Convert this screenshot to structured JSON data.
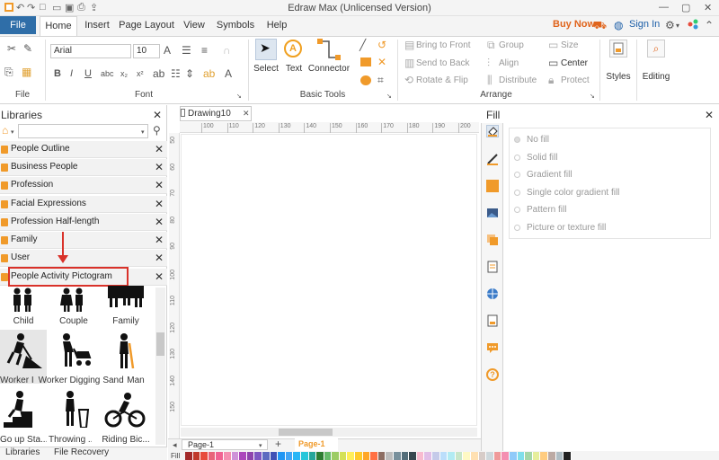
{
  "title": "Edraw Max (Unlicensed Version)",
  "menu": {
    "file": "File",
    "tabs": [
      "Home",
      "Insert",
      "Page Layout",
      "View",
      "Symbols",
      "Help"
    ]
  },
  "topright": {
    "buy": "Buy Now",
    "signin": "Sign In"
  },
  "ribbon": {
    "font_name": "Arial",
    "font_size": "10",
    "groups": {
      "file": "File",
      "font": "Font",
      "basic_tools": "Basic Tools",
      "arrange": "Arrange"
    },
    "tools": {
      "select": "Select",
      "text": "Text",
      "connector": "Connector"
    },
    "arrange": {
      "bring_front": "Bring to Front",
      "send_back": "Send to Back",
      "rotate_flip": "Rotate & Flip",
      "group": "Group",
      "align": "Align",
      "distribute": "Distribute",
      "size": "Size",
      "center": "Center",
      "protect": "Protect"
    },
    "styles": "Styles",
    "editing": "Editing"
  },
  "libraries": {
    "title": "Libraries",
    "items": [
      "People Outline",
      "Business People",
      "Profession",
      "Facial Expressions",
      "Profession Half-length",
      "Family",
      "User",
      "People Activity Pictogram"
    ],
    "shapes": [
      {
        "label": "Child"
      },
      {
        "label": "Couple"
      },
      {
        "label": "Family"
      },
      {
        "label": "Worker I"
      },
      {
        "label": "Worker Digging"
      },
      {
        "label": "Sand"
      },
      {
        "label": "Man"
      },
      {
        "label": "Go up Sta..."
      },
      {
        "label": "Throwing ..."
      },
      {
        "label": "Riding Bic..."
      }
    ],
    "bottom_tabs": [
      "Libraries",
      "File Recovery"
    ]
  },
  "document": {
    "tab": "Drawing10",
    "page_selector": "Page-1",
    "page_tab": "Page-1",
    "fill_label": "Fill"
  },
  "ruler": {
    "h_ticks": [
      "100",
      "110",
      "120",
      "130",
      "140",
      "150",
      "160",
      "170",
      "180",
      "190",
      "200"
    ],
    "v_ticks": [
      "50",
      "60",
      "70",
      "80",
      "90",
      "100",
      "110",
      "120",
      "130",
      "140",
      "150"
    ]
  },
  "fill": {
    "title": "Fill",
    "options": [
      "No fill",
      "Solid fill",
      "Gradient fill",
      "Single color gradient fill",
      "Pattern fill",
      "Picture or texture fill"
    ]
  },
  "colors": {
    "accent": "#2f6ea8",
    "highlight": "#d9322a",
    "buy": "#e0641c",
    "palette": [
      "#a32a2a",
      "#c0392b",
      "#e74c3c",
      "#e8647a",
      "#f06292",
      "#f48fb1",
      "#ce93d8",
      "#ab47bc",
      "#8e44ad",
      "#7e57c2",
      "#5c6bc0",
      "#3f51b5",
      "#2196f3",
      "#42a5f5",
      "#29b6f6",
      "#26c6da",
      "#26a69a",
      "#2e7d32",
      "#66bb6a",
      "#9ccc65",
      "#d4e157",
      "#ffee58",
      "#ffca28",
      "#ffa726",
      "#ff7043",
      "#8d6e63",
      "#bdbdbd",
      "#78909c",
      "#546e7a",
      "#37474f",
      "#f8bbd0",
      "#e1bee7",
      "#c5cae9",
      "#bbdefb",
      "#b2ebf2",
      "#c8e6c9",
      "#fff9c4",
      "#ffe0b2",
      "#d7ccc8",
      "#cfd8dc",
      "#ef9a9a",
      "#f48fb1",
      "#90caf9",
      "#80deea",
      "#a5d6a7",
      "#e6ee9c",
      "#ffcc80",
      "#bcaaa4",
      "#b0bec5",
      "#212121"
    ]
  }
}
